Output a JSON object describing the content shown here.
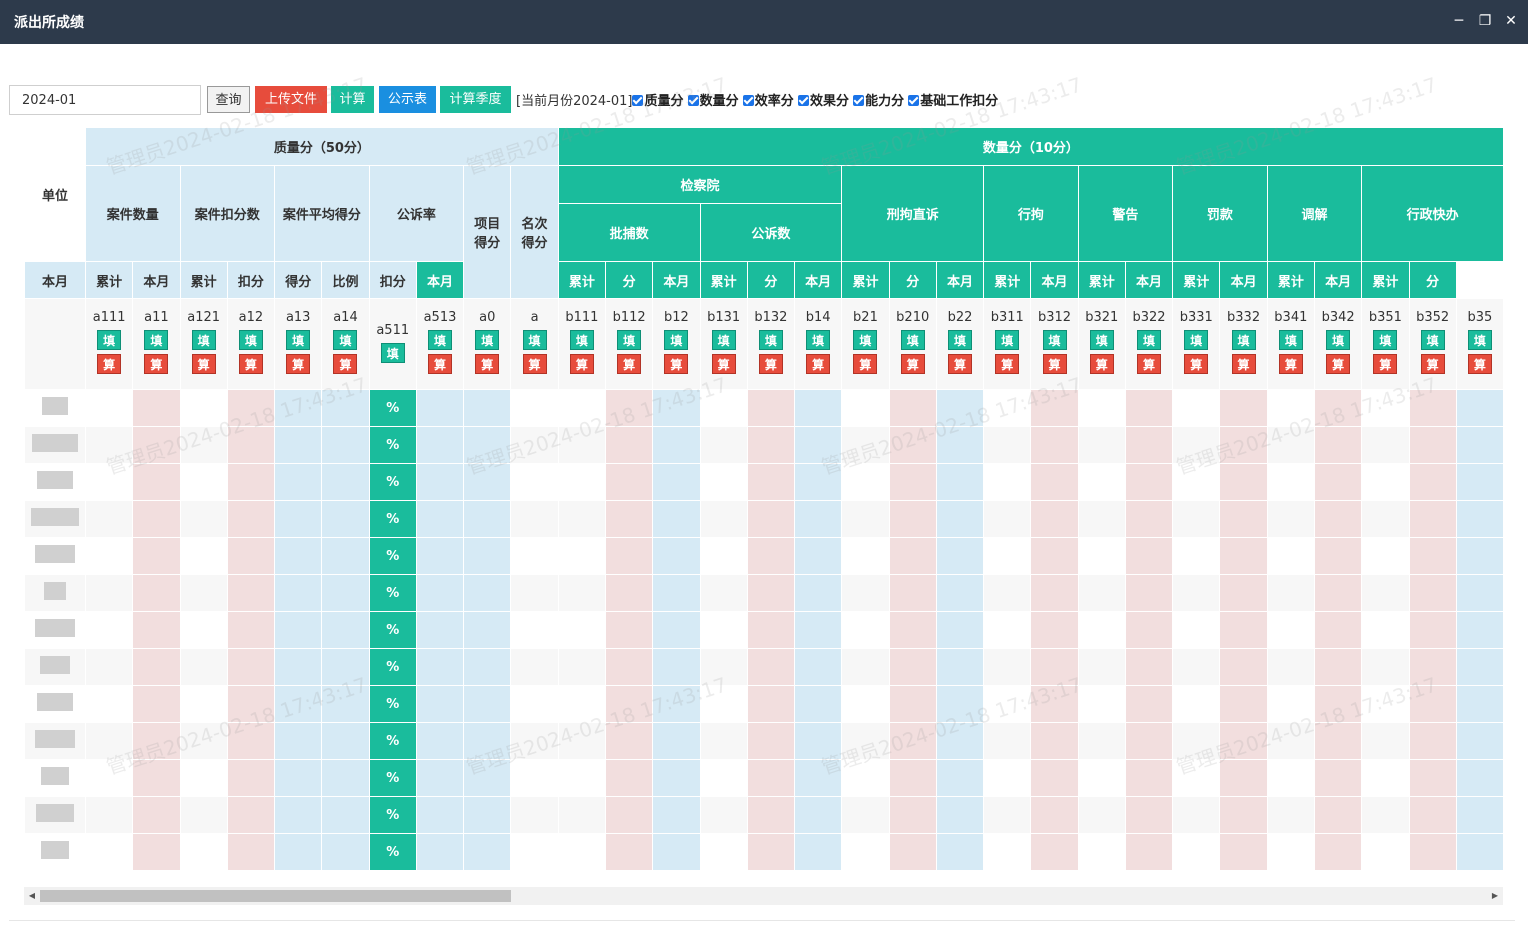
{
  "window": {
    "title": "派出所成绩",
    "minimize": "─",
    "maximize": "❐",
    "close": "✕"
  },
  "toolbar": {
    "month_value": "2024-01",
    "query_label": "查询",
    "upload_label": "上传文件",
    "calc_label": "计算",
    "publish_label": "公示表",
    "calc_quarter_label": "计算季度",
    "current_month": "[当前月份2024-01]",
    "checks": [
      "质量分",
      "数量分",
      "效率分",
      "效果分",
      "能力分",
      "基础工作扣分"
    ]
  },
  "colors": {
    "title_bar": "#2d3a4b",
    "green": "#1abc9c",
    "red": "#e74c3c",
    "blue": "#1a8fe0",
    "light_blue": "#d6eaf5",
    "pink": "#f2dede"
  },
  "table": {
    "unit_header": "单位",
    "quality_header": "质量分（50分）",
    "quantity_header": "数量分（10分）",
    "quality_groups": [
      "案件数量",
      "案件扣分数",
      "案件平均得分",
      "公诉率",
      "项目得分",
      "名次得分"
    ],
    "procuratorate": "检察院",
    "proc_sub": [
      "批捕数",
      "公诉数"
    ],
    "quantity_groups": [
      "刑拘直诉",
      "行拘",
      "警告",
      "罚款",
      "调解",
      "行政快办"
    ],
    "sub_month": "本月",
    "sub_total": "累计",
    "sub_deduct": "扣分",
    "sub_score": "得分",
    "sub_ratio": "比例",
    "sub_point": "分",
    "fill_label": "填",
    "calc_label": "算",
    "percent": "%",
    "codes": [
      "a111",
      "a11",
      "a121",
      "a12",
      "a13",
      "a14",
      "a511",
      "a513",
      "a0",
      "a",
      "b111",
      "b112",
      "b12",
      "b131",
      "b132",
      "b14",
      "b21",
      "b210",
      "b22",
      "b311",
      "b312",
      "b321",
      "b322",
      "b331",
      "b332",
      "b341",
      "b342",
      "b351",
      "b352",
      "b35"
    ]
  },
  "watermark": "管理员2024-02-18 17:43:17"
}
